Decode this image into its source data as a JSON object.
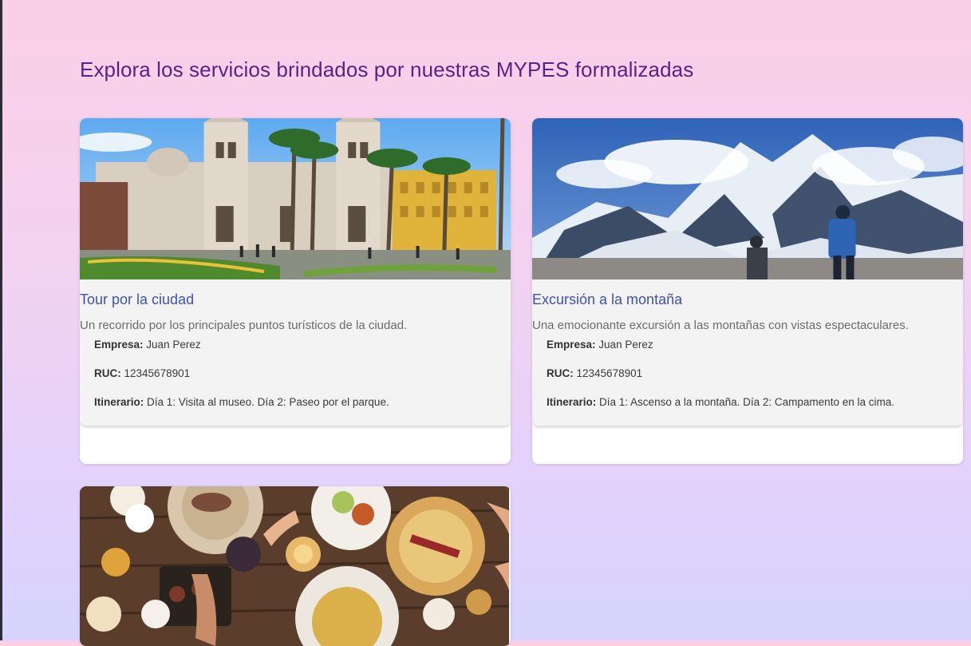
{
  "page": {
    "title": "Explora los servicios brindados por nuestras MYPES formalizadas"
  },
  "labels": {
    "empresa": "Empresa:",
    "ruc": "RUC:",
    "itinerario": "Itinerario:"
  },
  "cards": [
    {
      "title": "Tour por la ciudad",
      "description": "Un recorrido por los principales puntos turísticos de la ciudad.",
      "empresa": "Juan Perez",
      "ruc": "12345678901",
      "itinerario": "Día 1: Visita al museo. Día 2: Paseo por el parque.",
      "image": "city-plaza-cathedral-photo"
    },
    {
      "title": "Excursión a la montaña",
      "description": "Una emocionante excursión a las montañas con vistas espectaculares.",
      "empresa": "Juan Perez",
      "ruc": "12345678901",
      "itinerario": "Día 1: Ascenso a la montaña. Día 2: Campamento en la cima.",
      "image": "snowy-mountain-hikers-photo"
    },
    {
      "image": "food-table-overhead-photo"
    }
  ]
}
